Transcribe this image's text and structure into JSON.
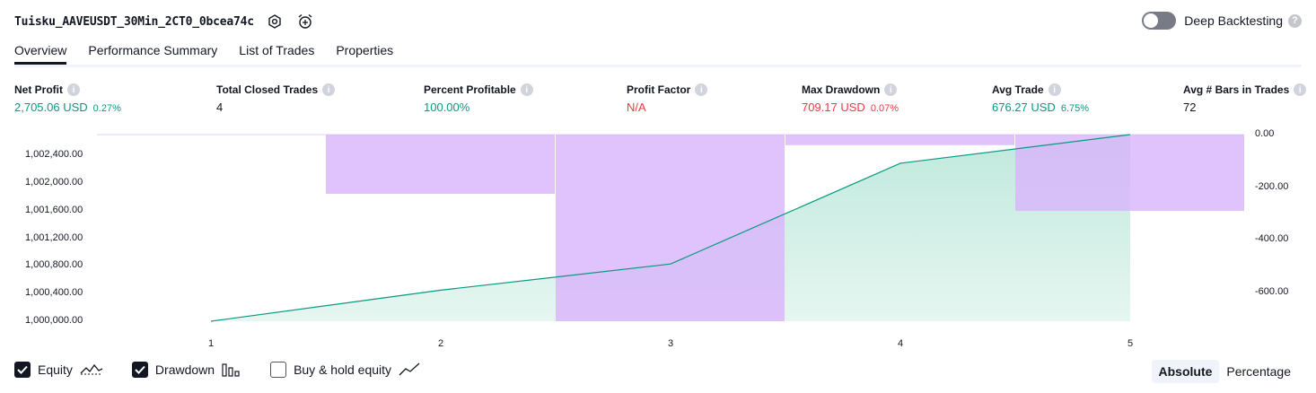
{
  "header": {
    "strategy_title": "Tuisku_AAVEUSDT_30Min_2CT0_0bcea74c",
    "deep_backtesting_label": "Deep Backtesting",
    "deep_backtesting_enabled": false
  },
  "tabs": [
    {
      "label": "Overview",
      "active": true
    },
    {
      "label": "Performance Summary",
      "active": false
    },
    {
      "label": "List of Trades",
      "active": false
    },
    {
      "label": "Properties",
      "active": false
    }
  ],
  "metrics": {
    "net_profit": {
      "label": "Net Profit",
      "value": "2,705.06 USD",
      "percent": "0.27%"
    },
    "total_closed_trades": {
      "label": "Total Closed Trades",
      "value": "4"
    },
    "percent_profitable": {
      "label": "Percent Profitable",
      "value": "100.00%"
    },
    "profit_factor": {
      "label": "Profit Factor",
      "value": "N/A"
    },
    "max_drawdown": {
      "label": "Max Drawdown",
      "value": "709.17 USD",
      "percent": "0.07%"
    },
    "avg_trade": {
      "label": "Avg Trade",
      "value": "676.27 USD",
      "percent": "6.75%"
    },
    "avg_bars": {
      "label": "Avg # Bars in Trades",
      "value": "72"
    }
  },
  "chart_data": {
    "type": "line",
    "x": [
      1,
      2,
      3,
      4,
      5
    ],
    "series": [
      {
        "name": "Equity",
        "type": "area",
        "axis": "left",
        "color": "#089981",
        "values": [
          1000000.0,
          1000450.0,
          1000830.0,
          1002290.0,
          1002705.06
        ]
      },
      {
        "name": "Drawdown",
        "type": "bar",
        "axis": "right",
        "color": "#ce93d8",
        "values": [
          -225,
          -709.17,
          -40,
          -290
        ]
      }
    ],
    "left_axis": {
      "ticks": [
        "1,000,000.00",
        "1,000,400.00",
        "1,000,800.00",
        "1,001,200.00",
        "1,001,600.00",
        "1,002,000.00",
        "1,002,400.00"
      ],
      "tick_values": [
        1000000,
        1000400,
        1000800,
        1001200,
        1001600,
        1002000,
        1002400
      ],
      "range": [
        1000000,
        1002705.06
      ]
    },
    "right_axis": {
      "ticks": [
        "0.00",
        "-200.00",
        "-400.00",
        "-600.00"
      ],
      "tick_values": [
        0,
        -200,
        -400,
        -600
      ],
      "range": [
        -709.17,
        0
      ]
    },
    "x_ticks": [
      "1",
      "2",
      "3",
      "4",
      "5"
    ],
    "grid": false
  },
  "legend": {
    "equity_label": "Equity",
    "equity_checked": true,
    "drawdown_label": "Drawdown",
    "drawdown_checked": true,
    "buyhold_label": "Buy & hold equity",
    "buyhold_checked": false
  },
  "mode_toggle": {
    "absolute_label": "Absolute",
    "percentage_label": "Percentage",
    "active": "Absolute"
  },
  "colors": {
    "positive": "#089981",
    "negative": "#f23645",
    "drawdown_fill": "#e1c2fb",
    "equity_fill": "#d8f2ea",
    "text": "#131722"
  }
}
